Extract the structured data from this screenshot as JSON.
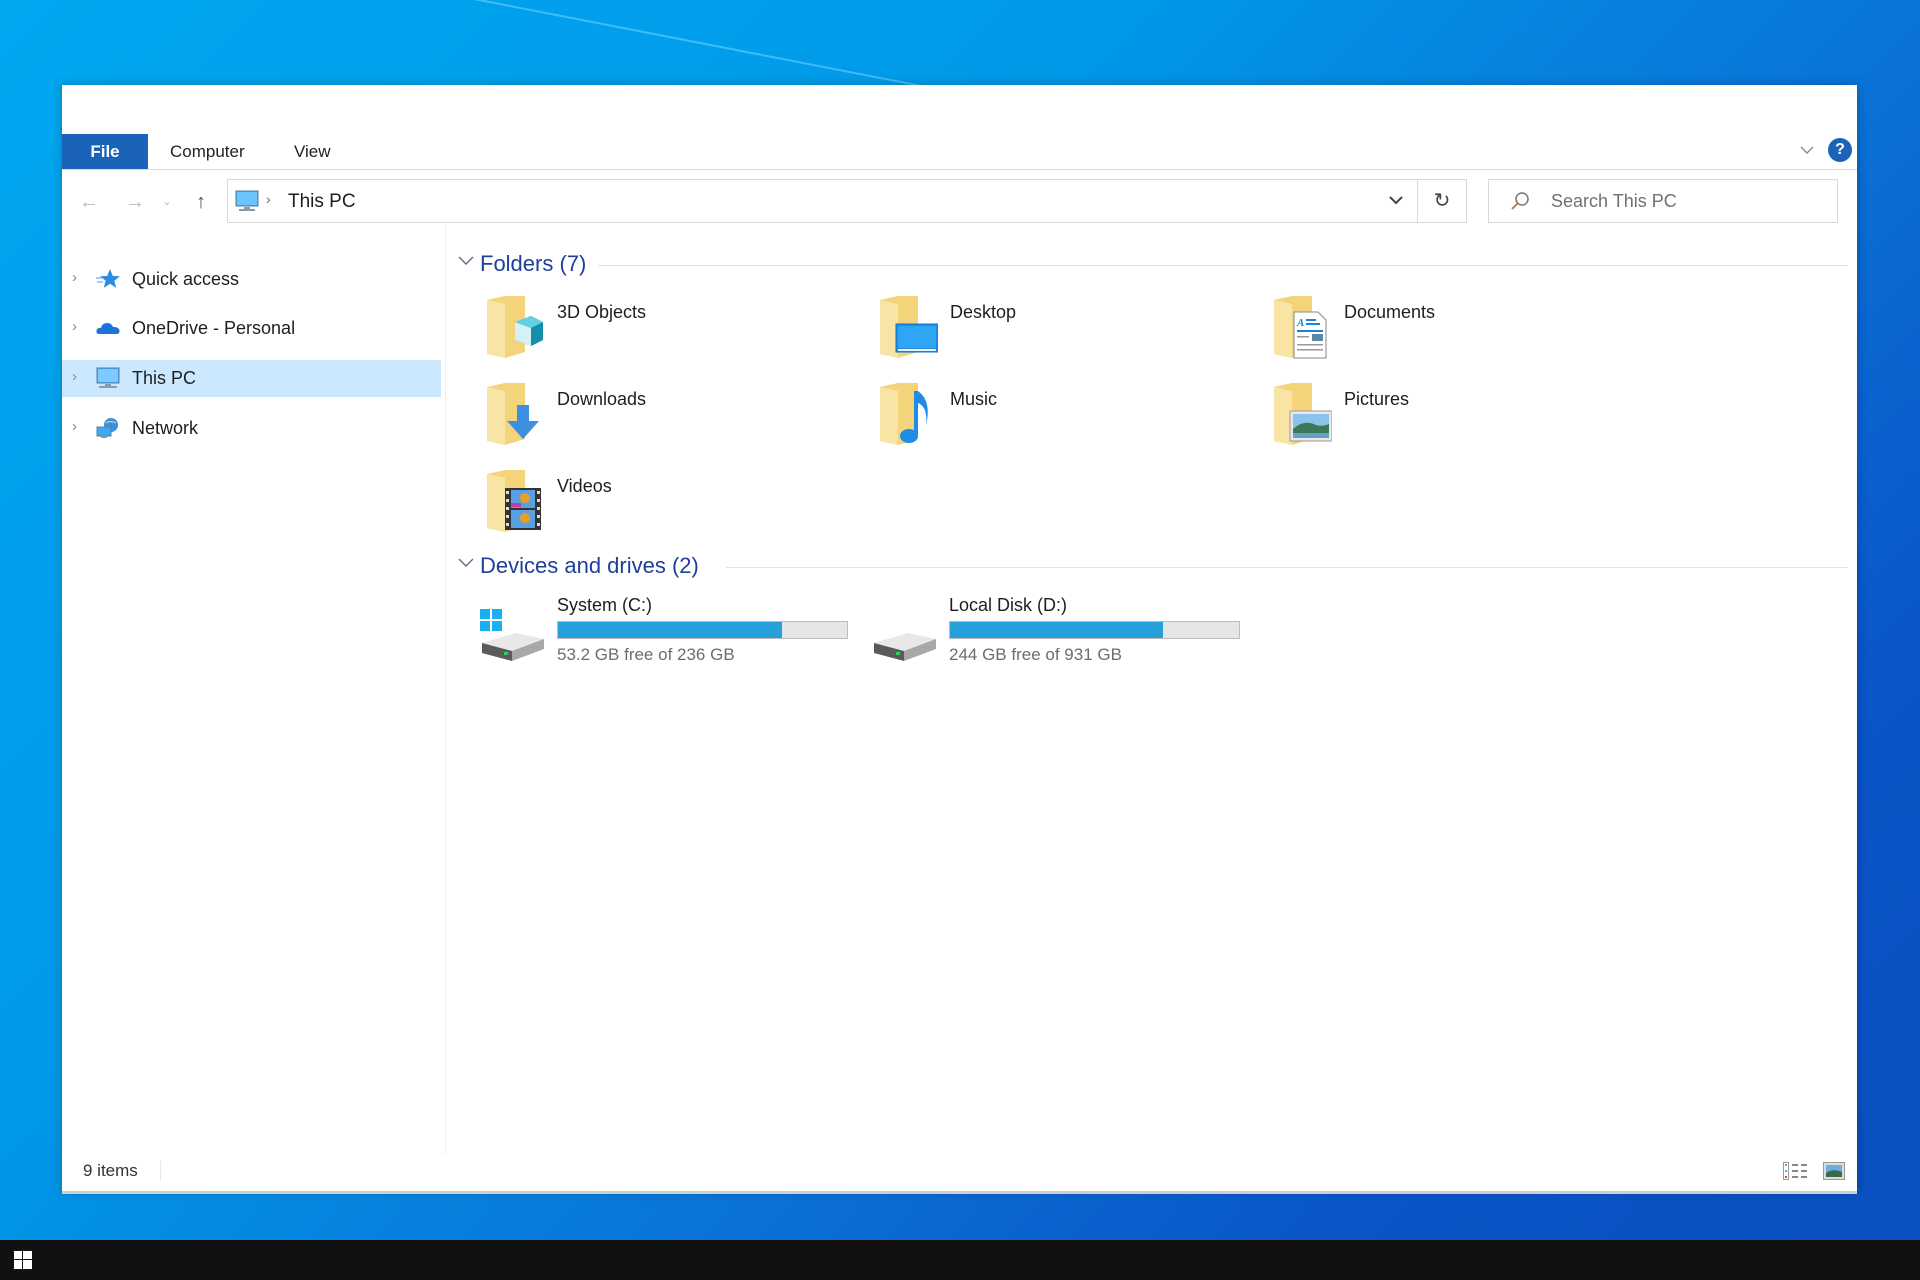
{
  "ribbon": {
    "tabs": [
      "File",
      "Computer",
      "View"
    ],
    "help_label": "?",
    "collapse_icon": "chevron-down-icon"
  },
  "nav": {
    "back_glyph": "←",
    "forward_glyph": "→",
    "recent_glyph": "⌄",
    "up_glyph": "↑"
  },
  "address": {
    "separator": "›",
    "crumbs": [
      "This PC"
    ],
    "dropdown_glyph": "⌄",
    "refresh_glyph": "↻"
  },
  "search": {
    "placeholder": "Search This PC"
  },
  "sidebar": {
    "items": [
      {
        "label": "Quick access",
        "icon": "quick-access-star-icon",
        "selected": false
      },
      {
        "label": "OneDrive - Personal",
        "icon": "onedrive-cloud-icon",
        "selected": false
      },
      {
        "label": "This PC",
        "icon": "this-pc-monitor-icon",
        "selected": true
      },
      {
        "label": "Network",
        "icon": "network-icon",
        "selected": false
      }
    ],
    "expand_glyph": "›"
  },
  "content": {
    "folders_header": "Folders (7)",
    "folders": [
      {
        "name": "3D Objects",
        "icon": "3d-objects-folder-icon"
      },
      {
        "name": "Desktop",
        "icon": "desktop-folder-icon"
      },
      {
        "name": "Documents",
        "icon": "documents-folder-icon"
      },
      {
        "name": "Downloads",
        "icon": "downloads-folder-icon"
      },
      {
        "name": "Music",
        "icon": "music-folder-icon"
      },
      {
        "name": "Pictures",
        "icon": "pictures-folder-icon"
      },
      {
        "name": "Videos",
        "icon": "videos-folder-icon"
      }
    ],
    "drives_header": "Devices and drives (2)",
    "drives": [
      {
        "name": "System (C:)",
        "free_text": "53.2 GB free of 236 GB",
        "used_fraction": 0.775,
        "icon": "system-drive-icon"
      },
      {
        "name": "Local Disk (D:)",
        "free_text": "244 GB free of 931 GB",
        "used_fraction": 0.738,
        "icon": "local-disk-icon"
      }
    ],
    "collapse_glyph": "⌄"
  },
  "status": {
    "item_count": "9 items"
  },
  "colors": {
    "accent": "#1a63b8",
    "selection": "#cce8ff",
    "progress": "#26a0da",
    "group_header": "#1e3f9a"
  }
}
